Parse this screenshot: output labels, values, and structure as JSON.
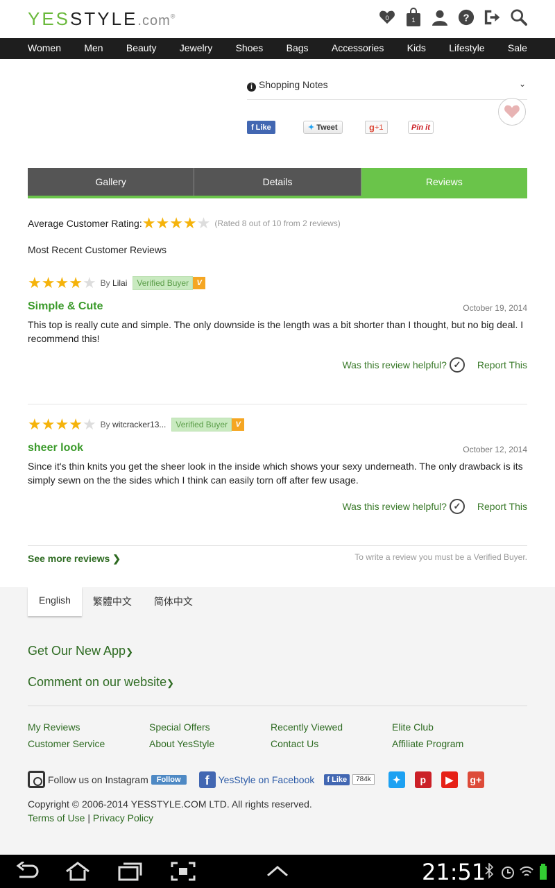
{
  "header": {
    "logo_yes": "YES",
    "logo_style": "STYLE",
    "logo_com": ".com",
    "logo_reg": "®",
    "wishlist_count": "0",
    "bag_count": "1",
    "icons": [
      "heart-icon",
      "bag-icon",
      "user-icon",
      "help-icon",
      "signout-icon",
      "search-icon"
    ]
  },
  "nav": [
    "Women",
    "Men",
    "Beauty",
    "Jewelry",
    "Shoes",
    "Bags",
    "Accessories",
    "Kids",
    "Lifestyle",
    "Sale"
  ],
  "product": {
    "shopping_notes": "Shopping Notes",
    "fb_like": "Like",
    "tweet": "Tweet",
    "gplus": "+1",
    "pinit": "Pin it"
  },
  "tabs": [
    {
      "label": "Gallery",
      "active": false
    },
    {
      "label": "Details",
      "active": false
    },
    {
      "label": "Reviews",
      "active": true
    }
  ],
  "reviews": {
    "avg_label": "Average Customer Rating:",
    "avg_rating": 4,
    "avg_note": "(Rated 8 out of 10 from 2 reviews)",
    "recent_label": "Most Recent Customer Reviews",
    "by": "By",
    "verified": "Verified Buyer",
    "verified_mark": "V",
    "helpful": "Was this review helpful?",
    "report": "Report This",
    "items": [
      {
        "rating": 4,
        "author": "Lilai",
        "title": "Simple & Cute",
        "date": "October 19, 2014",
        "body": "This top is really cute and simple. The only downside is the length was a bit shorter than I thought, but no big deal. I recommend this!"
      },
      {
        "rating": 4,
        "author": "witcracker13...",
        "title": "sheer look",
        "date": "October 12, 2014",
        "body": "Since it's thin knits you get the sheer look in the inside which shows your sexy underneath. The only drawback is its simply sewn on the the sides which I think can easily torn off after few usage."
      }
    ],
    "see_more": "See more reviews",
    "must_be": "To write a review you must be a Verified Buyer."
  },
  "footer": {
    "languages": [
      {
        "label": "English",
        "active": true
      },
      {
        "label": "繁體中文",
        "active": false
      },
      {
        "label": "简体中文",
        "active": false
      }
    ],
    "get_app": "Get Our New App",
    "comment": "Comment on our website",
    "links": [
      "My Reviews",
      "Special Offers",
      "Recently Viewed",
      "Elite Club",
      "Customer Service",
      "About YesStyle",
      "Contact Us",
      "Affiliate Program"
    ],
    "instagram_text": "Follow us on Instagram",
    "follow_btn": "Follow",
    "facebook_text": "YesStyle on Facebook",
    "fb_like": "Like",
    "fb_count": "784k",
    "copyright": "Copyright © 2006-2014 YESSTYLE.COM LTD. All rights reserved.",
    "terms": "Terms of Use",
    "terms_sep": "|",
    "privacy": "Privacy Policy"
  },
  "system": {
    "clock": "21:51"
  },
  "colors": {
    "brand_green": "#6ac44a",
    "link_green": "#2e6b22",
    "star_gold": "#f5b30b",
    "nav_dark": "#1e1e1e"
  }
}
